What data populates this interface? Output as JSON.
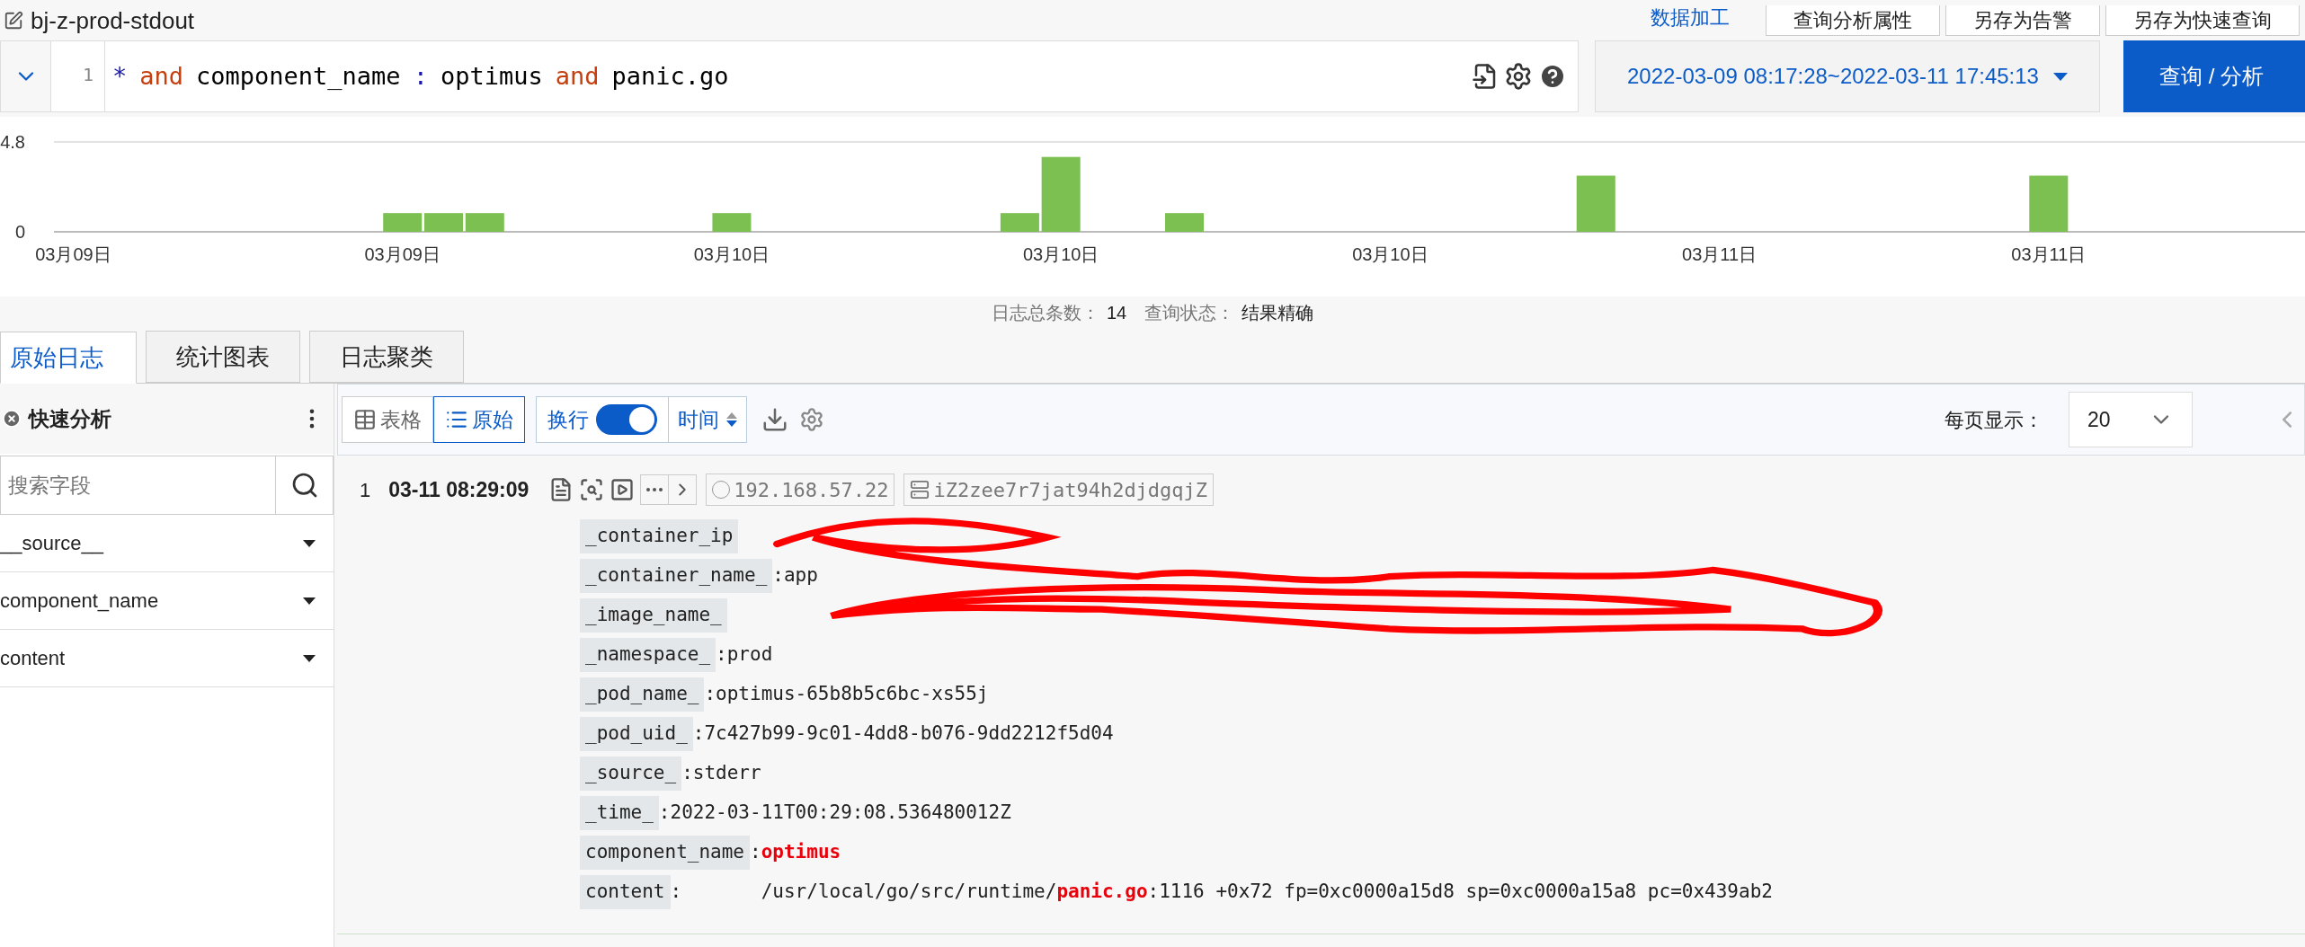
{
  "header": {
    "title": "bj-z-prod-stdout",
    "link": "数据加工",
    "tabs": [
      {
        "label": "查询分析属性"
      },
      {
        "label": "另存为告警"
      },
      {
        "label": "另存为快速查询"
      }
    ]
  },
  "query": {
    "line_number": "1",
    "tokens": [
      {
        "kind": "wildcard",
        "text": "*"
      },
      {
        "kind": "keyword",
        "text": "and"
      },
      {
        "kind": "text",
        "text": "component_name"
      },
      {
        "kind": "operator",
        "text": ":"
      },
      {
        "kind": "text",
        "text": "optimus"
      },
      {
        "kind": "keyword",
        "text": "and"
      },
      {
        "kind": "text",
        "text": "panic.go"
      }
    ],
    "time_range": "2022-03-09 08:17:28~2022-03-11 17:45:13",
    "submit": "查询 / 分析"
  },
  "histogram": {
    "chart_data": {
      "type": "bar",
      "categories": [
        "03月09日",
        null,
        null,
        null,
        null,
        null,
        null,
        null,
        "03月09日",
        null,
        null,
        null,
        null,
        null,
        null,
        null,
        "03月10日",
        null,
        null,
        null,
        null,
        null,
        null,
        null,
        "03月10日",
        null,
        null,
        null,
        null,
        null,
        null,
        null,
        "03月10日",
        null,
        null,
        null,
        null,
        null,
        null,
        null,
        "03月11日",
        null,
        null,
        null,
        null,
        null,
        null,
        null,
        "03月11日",
        null,
        null,
        null,
        null,
        null,
        null
      ],
      "values": [
        null,
        null,
        null,
        null,
        null,
        null,
        null,
        null,
        1,
        1,
        1,
        null,
        null,
        null,
        null,
        null,
        1,
        null,
        null,
        null,
        null,
        null,
        null,
        1,
        4,
        null,
        null,
        1,
        null,
        null,
        null,
        null,
        null,
        null,
        null,
        null,
        null,
        3,
        null,
        null,
        null,
        null,
        null,
        null,
        null,
        null,
        null,
        null,
        3,
        null,
        null,
        null,
        null,
        null,
        null
      ],
      "ylim": [
        0,
        4.8
      ],
      "yticks": [
        0,
        4.8
      ]
    }
  },
  "summary": {
    "count_label": "日志总条数：",
    "count": "14",
    "status_label": "查询状态：",
    "status": "结果精确"
  },
  "view_tabs": [
    {
      "label": "原始日志",
      "selected": true
    },
    {
      "label": "统计图表",
      "selected": false
    },
    {
      "label": "日志聚类",
      "selected": false
    }
  ],
  "sidebar": {
    "title": "快速分析",
    "search_placeholder": "搜索字段",
    "fields": [
      {
        "name": "__source__"
      },
      {
        "name": "component_name"
      },
      {
        "name": "content"
      }
    ]
  },
  "toolbar": {
    "modes": [
      {
        "label": "表格",
        "kind": "table",
        "selected": false
      },
      {
        "label": "原始",
        "kind": "raw",
        "selected": true
      }
    ],
    "wrap": {
      "label": "换行",
      "on": true
    },
    "sort": "时间",
    "page_size_label": "每页显示：",
    "page_size": "20"
  },
  "log": {
    "index": "1",
    "time": "03-11 08:29:09",
    "ip": "192.168.57.22",
    "host": "iZ2zee7r7jat94h2djdgqjZ",
    "fields": [
      {
        "key": "_container_ip"
      },
      {
        "key": "_container_name_",
        "segments": [
          {
            "text": ":app",
            "highlight": false
          }
        ]
      },
      {
        "key": "_image_name_"
      },
      {
        "key": "_namespace_",
        "segments": [
          {
            "text": ":prod",
            "highlight": false
          }
        ]
      },
      {
        "key": "_pod_name_",
        "segments": [
          {
            "text": ":optimus-65b8b5c6bc-xs55j",
            "highlight": false
          }
        ]
      },
      {
        "key": "_pod_uid_",
        "segments": [
          {
            "text": ":7c427b99-9c01-4dd8-b076-9dd2212f5d04",
            "highlight": false
          }
        ]
      },
      {
        "key": "_source_",
        "segments": [
          {
            "text": ":stderr",
            "highlight": false
          }
        ]
      },
      {
        "key": "_time_",
        "segments": [
          {
            "text": ":2022-03-11T00:29:08.536480012Z",
            "highlight": false
          }
        ]
      },
      {
        "key": "component_name",
        "segments": [
          {
            "text": ":",
            "highlight": false
          },
          {
            "text": "optimus",
            "highlight": true
          }
        ]
      },
      {
        "key": "content",
        "segments": [
          {
            "text": ":       /usr/local/go/src/runtime/",
            "highlight": false
          },
          {
            "text": "panic.go",
            "highlight": true
          },
          {
            "text": ":1116 +0x72 fp=0xc0000a15d8 sp=0xc0000a15a8 pc=0x439ab2",
            "highlight": false
          }
        ]
      }
    ]
  }
}
